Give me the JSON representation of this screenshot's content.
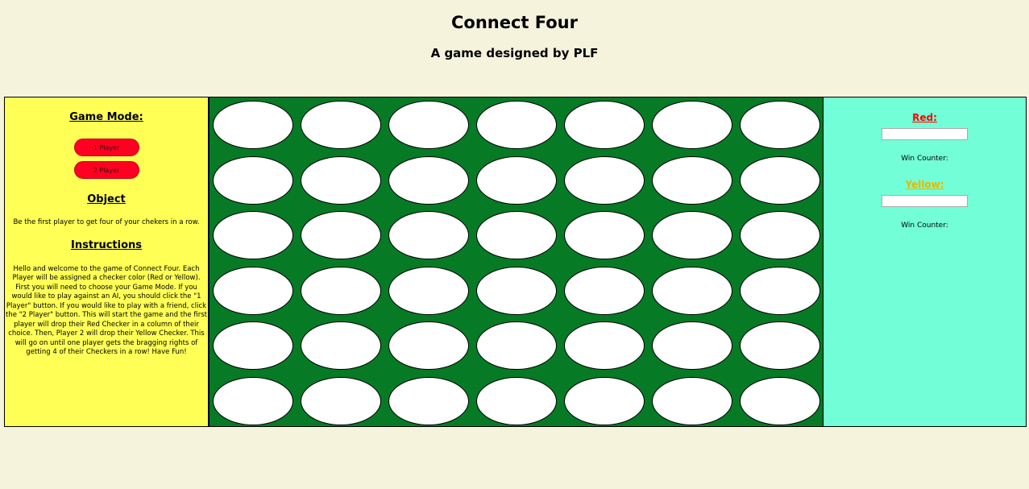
{
  "header": {
    "title": "Connect Four",
    "subtitle": "A game designed by PLF"
  },
  "left_panel": {
    "game_mode_heading": "Game Mode:",
    "one_player_label": "1 Player",
    "two_player_label": "2 Player",
    "object_heading": "Object",
    "object_text": "Be the first player to get four of your chekers in a row.",
    "instructions_heading": "Instructions",
    "instructions_text": "Hello and welcome to the game of Connect Four. Each Player will be assigned a checker color (Red or Yellow). First you will need to choose your Game Mode. If you would like to play against an AI, you should click the \"1 Player\" button. If you would like to play with a friend, click the \"2 Player\" button. This will start the game and the first player will drop their Red Checker in a column of their choice. Then, Player 2 will drop their Yellow Checker. This will go on until one player gets the bragging rights of getting 4 of their Checkers in a row! Have Fun!"
  },
  "board": {
    "columns": 7,
    "rows": 6,
    "board_color": "#067a25",
    "empty_cell_color": "#ffffff"
  },
  "right_panel": {
    "red_label": "Red:",
    "red_color": "#ff0000",
    "red_name_value": "",
    "red_win_counter_label": "Win Counter:",
    "yellow_label": "Yellow:",
    "yellow_color": "#e6b800",
    "yellow_name_value": "",
    "yellow_win_counter_label": "Win Counter:"
  },
  "colors": {
    "page_background": "#f5f3dc",
    "left_panel_background": "#ffff55",
    "right_panel_background": "#72ffd7",
    "mode_button_color": "#ff0022"
  }
}
